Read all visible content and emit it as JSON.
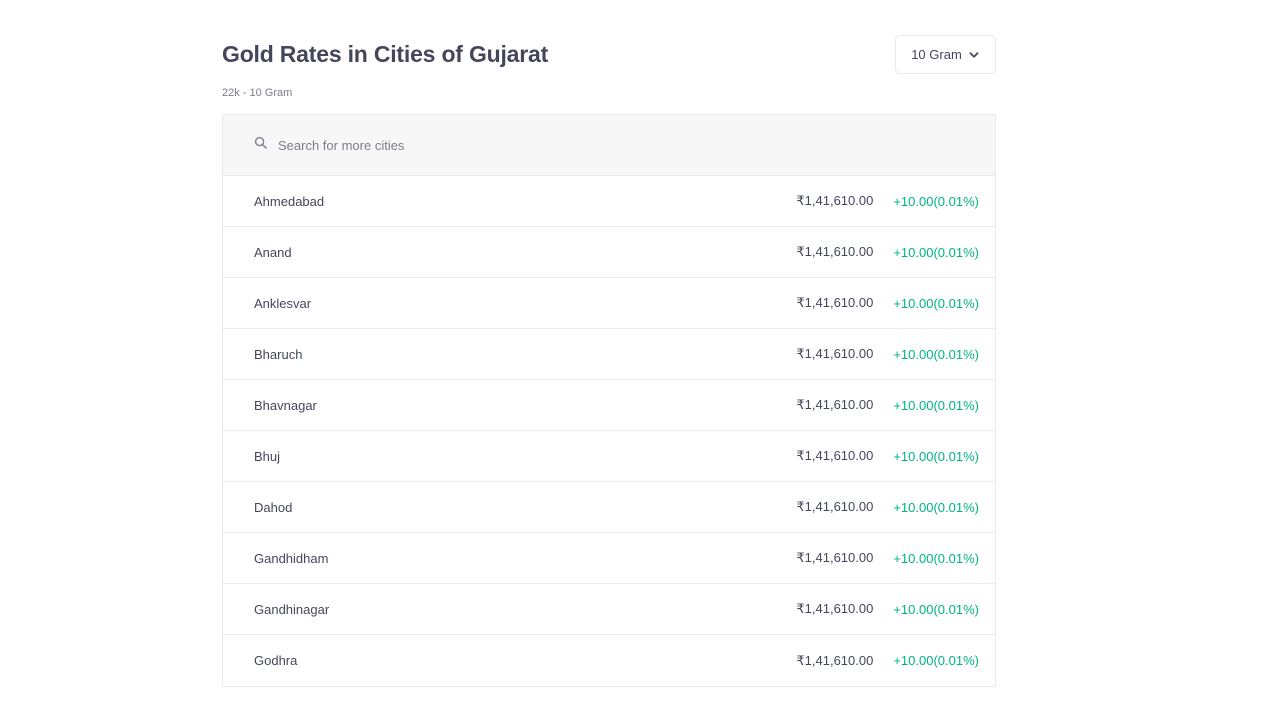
{
  "header": {
    "title": "Gold Rates in Cities of Gujarat",
    "subtitle": "22k - 10 Gram",
    "unit_selector": "10 Gram"
  },
  "search": {
    "placeholder": "Search for more cities"
  },
  "colors": {
    "positive": "#00b386",
    "text": "#44475b",
    "muted": "#7c7e8c"
  },
  "rows": [
    {
      "city": "Ahmedabad",
      "price": "₹1,41,610.00",
      "change": "+10.00(0.01%)"
    },
    {
      "city": "Anand",
      "price": "₹1,41,610.00",
      "change": "+10.00(0.01%)"
    },
    {
      "city": "Anklesvar",
      "price": "₹1,41,610.00",
      "change": "+10.00(0.01%)"
    },
    {
      "city": "Bharuch",
      "price": "₹1,41,610.00",
      "change": "+10.00(0.01%)"
    },
    {
      "city": "Bhavnagar",
      "price": "₹1,41,610.00",
      "change": "+10.00(0.01%)"
    },
    {
      "city": "Bhuj",
      "price": "₹1,41,610.00",
      "change": "+10.00(0.01%)"
    },
    {
      "city": "Dahod",
      "price": "₹1,41,610.00",
      "change": "+10.00(0.01%)"
    },
    {
      "city": "Gandhidham",
      "price": "₹1,41,610.00",
      "change": "+10.00(0.01%)"
    },
    {
      "city": "Gandhinagar",
      "price": "₹1,41,610.00",
      "change": "+10.00(0.01%)"
    },
    {
      "city": "Godhra",
      "price": "₹1,41,610.00",
      "change": "+10.00(0.01%)"
    }
  ]
}
